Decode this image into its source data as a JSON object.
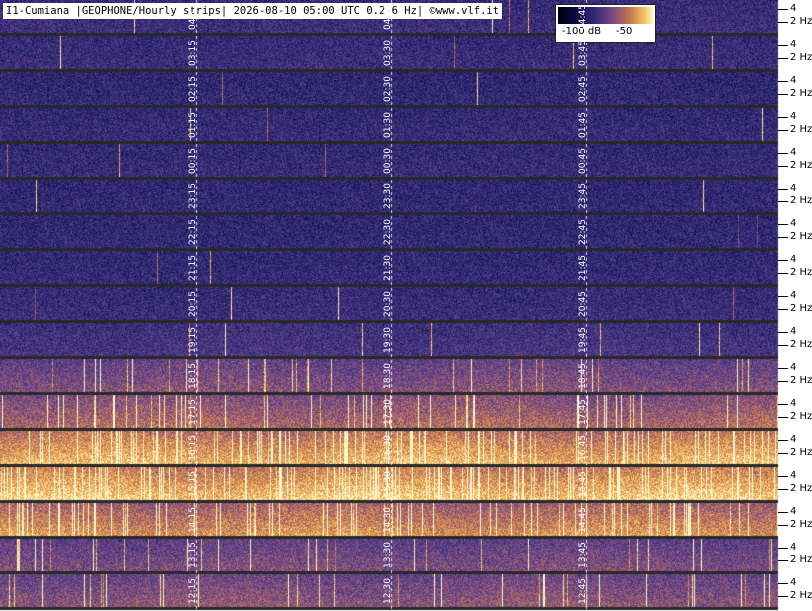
{
  "header": {
    "title": "I1-Cumiana |GEOPHONE/Hourly strips| 2026-08-10 05:00 UTC 0.2-6 Hz| ©www.vlf.it"
  },
  "colorbar": {
    "min_label": "-100 dB",
    "max_label": "-50"
  },
  "freq_ticks": {
    "upper": "4",
    "lower": "2 Hz"
  },
  "chart_data": {
    "type": "heatmap",
    "title": "I1-Cumiana |GEOPHONE/Hourly strips| 2026-08-10 05:00 UTC 0.2-6 Hz| ©www.vlf.it",
    "xlabel": "",
    "ylabel": "",
    "freq_range_hz": [
      0.2,
      6
    ],
    "freq_ticks_hz": [
      2,
      4
    ],
    "color_range_db": [
      -100,
      -50
    ],
    "strips": [
      {
        "hour": "04",
        "labels": [
          "04:15",
          "04:30",
          "04:45"
        ],
        "level": 0.15
      },
      {
        "hour": "03",
        "labels": [
          "03:15",
          "03:30",
          "03:45"
        ],
        "level": 0.14
      },
      {
        "hour": "02",
        "labels": [
          "02:15",
          "02:30",
          "02:45"
        ],
        "level": 0.1
      },
      {
        "hour": "01",
        "labels": [
          "01:15",
          "01:30",
          "01:45"
        ],
        "level": 0.12
      },
      {
        "hour": "00",
        "labels": [
          "00:15",
          "00:30",
          "00:45"
        ],
        "level": 0.12
      },
      {
        "hour": "23",
        "labels": [
          "23:15",
          "23:30",
          "23:45"
        ],
        "level": 0.1
      },
      {
        "hour": "22",
        "labels": [
          "22:15",
          "22:30",
          "22:45"
        ],
        "level": 0.1
      },
      {
        "hour": "21",
        "labels": [
          "21:15",
          "21:30",
          "21:45"
        ],
        "level": 0.11
      },
      {
        "hour": "20",
        "labels": [
          "20:15",
          "20:30",
          "20:45"
        ],
        "level": 0.14
      },
      {
        "hour": "19",
        "labels": [
          "19:15",
          "19:30",
          "19:45"
        ],
        "level": 0.2
      },
      {
        "hour": "18",
        "labels": [
          "18:15",
          "18:30",
          "18:45"
        ],
        "level": 0.42
      },
      {
        "hour": "17",
        "labels": [
          "17:15",
          "17:30",
          "17:45"
        ],
        "level": 0.55
      },
      {
        "hour": "16",
        "labels": [
          "16:15",
          "16:30",
          "16:45"
        ],
        "level": 0.8
      },
      {
        "hour": "15",
        "labels": [
          "15:15",
          "15:30",
          "15:45"
        ],
        "level": 0.86
      },
      {
        "hour": "14",
        "labels": [
          "14:15",
          "14:30",
          "14:45"
        ],
        "level": 0.7
      },
      {
        "hour": "13",
        "labels": [
          "13:15",
          "13:30",
          "13:45"
        ],
        "level": 0.4
      },
      {
        "hour": "12",
        "labels": [
          "12:15",
          "12:30",
          "12:45"
        ],
        "level": 0.45
      }
    ]
  }
}
